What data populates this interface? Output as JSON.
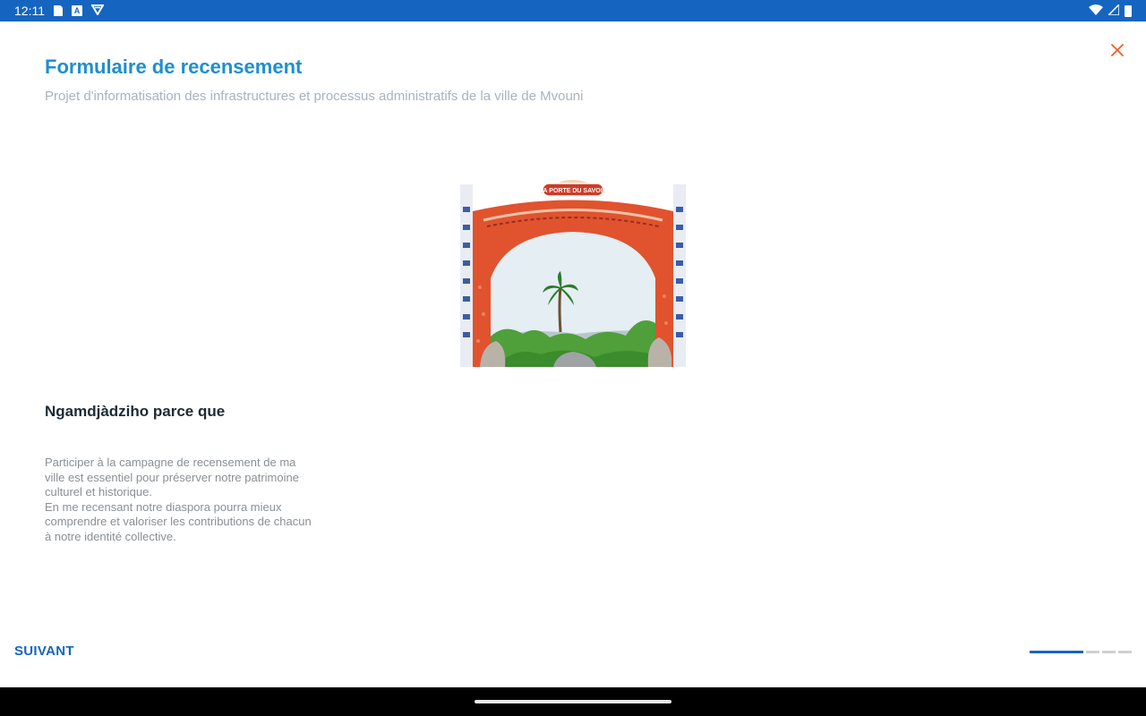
{
  "status_bar": {
    "time": "12:11",
    "left_icons": [
      "sd-card-icon",
      "text-a-icon",
      "vpn-shield-icon"
    ],
    "right_icons": [
      "wifi-icon",
      "cell-signal-icon",
      "battery-icon"
    ],
    "background": "#1565c0"
  },
  "form": {
    "title": "Formulaire de recensement",
    "subtitle": "Projet d'informatisation des infrastructures et processus administratifs de la ville de Mvouni",
    "section_heading": "Ngamdjàdziho parce que",
    "body_text": "Participer à la campagne de recensement de ma\nville est essentiel pour préserver notre patrimoine\nculturel et historique.\nEn me recensant notre diaspora pourra mieux\ncomprendre et valoriser les contributions de chacun\nà notre identité collective.",
    "image_sign_text": "LA PORTE DU SAVOIR",
    "close_icon": "close-icon",
    "accent_color": "#1f8fce",
    "close_color": "#e8622a"
  },
  "footer": {
    "next_label": "SUIVANT",
    "step_count": 4,
    "current_step": 1
  }
}
